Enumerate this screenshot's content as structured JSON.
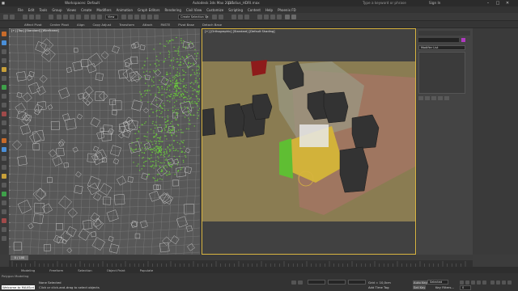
{
  "window": {
    "app_title": "Autodesk 3ds Max 2017",
    "file_name": "prudius_HDRI.max",
    "workspace_label": "Workspaces: Default",
    "search_placeholder": "Type a keyword or phrase",
    "sign_in": "Sign In",
    "minimize_glyph": "–",
    "maximize_glyph": "□",
    "close_glyph": "✕"
  },
  "menu": [
    "File",
    "Edit",
    "Tools",
    "Group",
    "Views",
    "Create",
    "Modifiers",
    "Animation",
    "Graph Editors",
    "Rendering",
    "Civil View",
    "Customize",
    "Scripting",
    "Content",
    "Help",
    "Phoenix FD"
  ],
  "toolbar": {
    "selection_set": "Create Selection Se",
    "view_dropdown": "View",
    "snap_counter": "3"
  },
  "ribbon": {
    "items": [
      "Affect Pivot",
      "Center Pivot",
      "Align",
      "Copy Adjust",
      "Transform",
      "Attach",
      "PASTE",
      "Pivot Base",
      "Detach Base"
    ]
  },
  "viewports": {
    "left_label": "[+] [Top] [Standard] [Wireframe]",
    "right_label": "[+] [Orthographic] [Standard] [Default Shading]"
  },
  "command_panel": {
    "modifier_list": "Modifier List"
  },
  "timeline": {
    "position": "0 / 100"
  },
  "scene_tabs": [
    "Modeling",
    "Freeform",
    "Selection",
    "Object Paint",
    "Populate"
  ],
  "statusbar": {
    "maxscript_label": "Welcome to MAXScri",
    "polygon_modeling": "Polygon Modeling",
    "selection_status": "None Selected",
    "prompt": "Click or click-and-drag to select objects",
    "grid": "Grid = 10,0cm",
    "add_time_tag": "Add Time Tag",
    "auto_key": "Auto Key",
    "key_mode": "Selected",
    "set_key": "Set Key",
    "key_filters": "Key Filters...",
    "frame": "0"
  },
  "colors": {
    "accent_yellow": "#d8b440",
    "wire_green": "#6bd23a",
    "ground": "#8a7c52",
    "path_salmon": "#b07a64",
    "building_dark": "#333333"
  }
}
